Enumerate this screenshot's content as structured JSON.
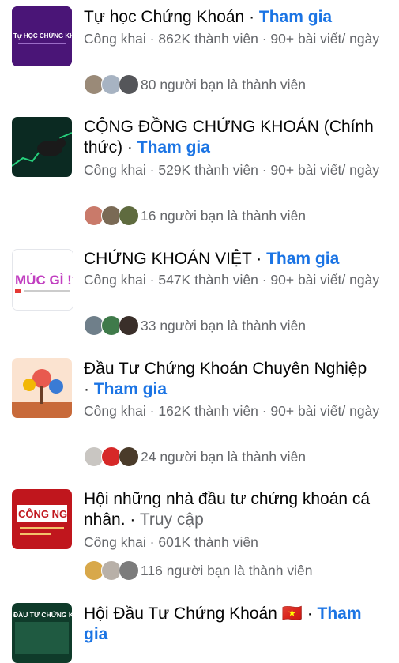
{
  "groups": [
    {
      "title": "Tự học Chứng Khoán",
      "action": "Tham gia",
      "meta": "Công khai · 862K thành viên · 90+ bài viết/ ngày",
      "friends": "80 người bạn là thành viên",
      "thumb_text": "Tự HỌC CHỨNG KHO"
    },
    {
      "title": "CỘNG ĐỒNG CHỨNG KHOÁN (Chính thức)",
      "action": "Tham gia",
      "meta": "Công khai · 529K thành viên · 90+ bài viết/ ngày",
      "friends": "16 người bạn là thành viên"
    },
    {
      "title": "CHỨNG KHOÁN VIỆT",
      "action": "Tham gia",
      "meta": "Công khai · 547K thành viên · 90+ bài viết/ ngày",
      "friends": "33 người bạn là thành viên",
      "thumb_text": "MÚC GÌ !?"
    },
    {
      "title": "Đầu Tư Chứng Khoán Chuyên Nghiệp",
      "action": "Tham gia",
      "meta": "Công khai · 162K thành viên · 90+ bài viết/ ngày",
      "friends": "24 người bạn là thành viên"
    },
    {
      "title": "Hội những nhà đầu tư chứng khoán cá nhân.",
      "action": "Truy cập",
      "meta": "Công khai · 601K thành viên",
      "friends": "116 người bạn là thành viên",
      "thumb_text": "CÔNG NGHỆ"
    },
    {
      "title": "Hội Đầu Tư Chứng Khoán 🇻🇳",
      "action": "Tham gia",
      "thumb_text": "ĐẦU TƯ CHỨNG KHOÁ"
    }
  ],
  "colors": {
    "link_blue": "#1b74e4",
    "meta_gray": "#65676b",
    "title_black": "#050505"
  }
}
